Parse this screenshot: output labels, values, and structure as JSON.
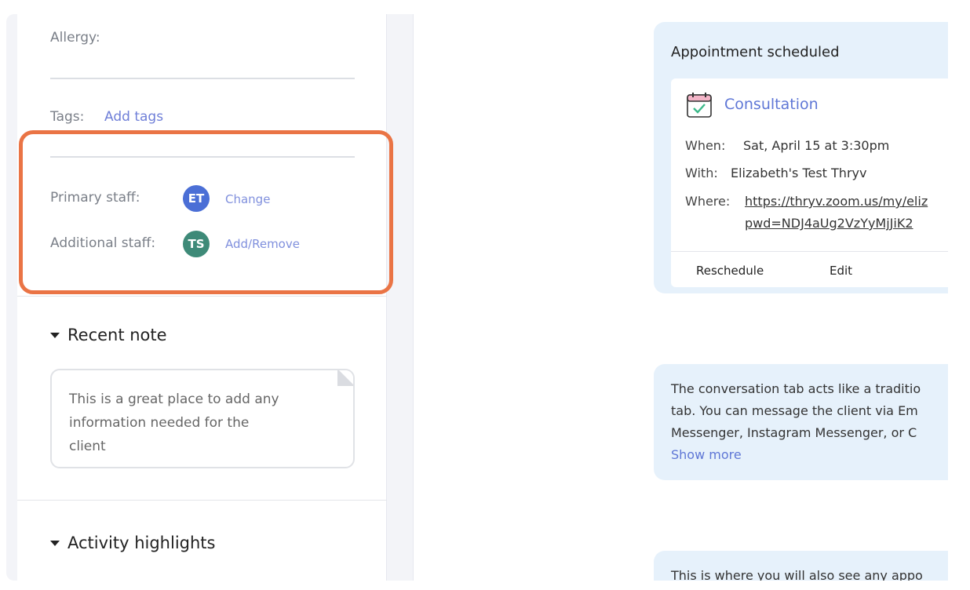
{
  "client": {
    "allergy_label": "Allergy:",
    "tags_label": "Tags:",
    "add_tags": "Add tags",
    "primary_staff_label": "Primary staff:",
    "primary_staff_initials": "ET",
    "change_link": "Change",
    "additional_staff_label": "Additional staff:",
    "additional_staff_initials": "TS",
    "add_remove_link": "Add/Remove"
  },
  "recent_note": {
    "title": "Recent note",
    "lines": [
      "This is a great place to add any",
      "information needed for the",
      "client"
    ]
  },
  "activity": {
    "title": "Activity highlights"
  },
  "appointment": {
    "header": "Appointment scheduled",
    "service": "Consultation",
    "when_label": "When:",
    "when_value": "Sat, April 15 at 3:30pm",
    "with_label": "With:",
    "with_value": "Elizabeth's Test Thryv",
    "where_label": "Where:",
    "where_line1": "https://thryv.zoom.us/my/eliz",
    "where_line2": "pwd=NDJ4aUg2VzYyMjJiK2",
    "reschedule": "Reschedule",
    "edit": "Edit"
  },
  "conversation_info": {
    "lines": [
      "The conversation tab acts like a traditio",
      "tab. You can message the client via Em",
      "Messenger, Instagram Messenger, or C"
    ],
    "show_more": "Show more"
  },
  "appointments_info": {
    "line": "This is where you will also see any appo"
  },
  "colors": {
    "highlight": "#ea7445",
    "primary_avatar": "#4b6fd6",
    "additional_avatar": "#3e8a78",
    "link": "#6f7fd8",
    "card_bg": "#e6f1fb"
  }
}
